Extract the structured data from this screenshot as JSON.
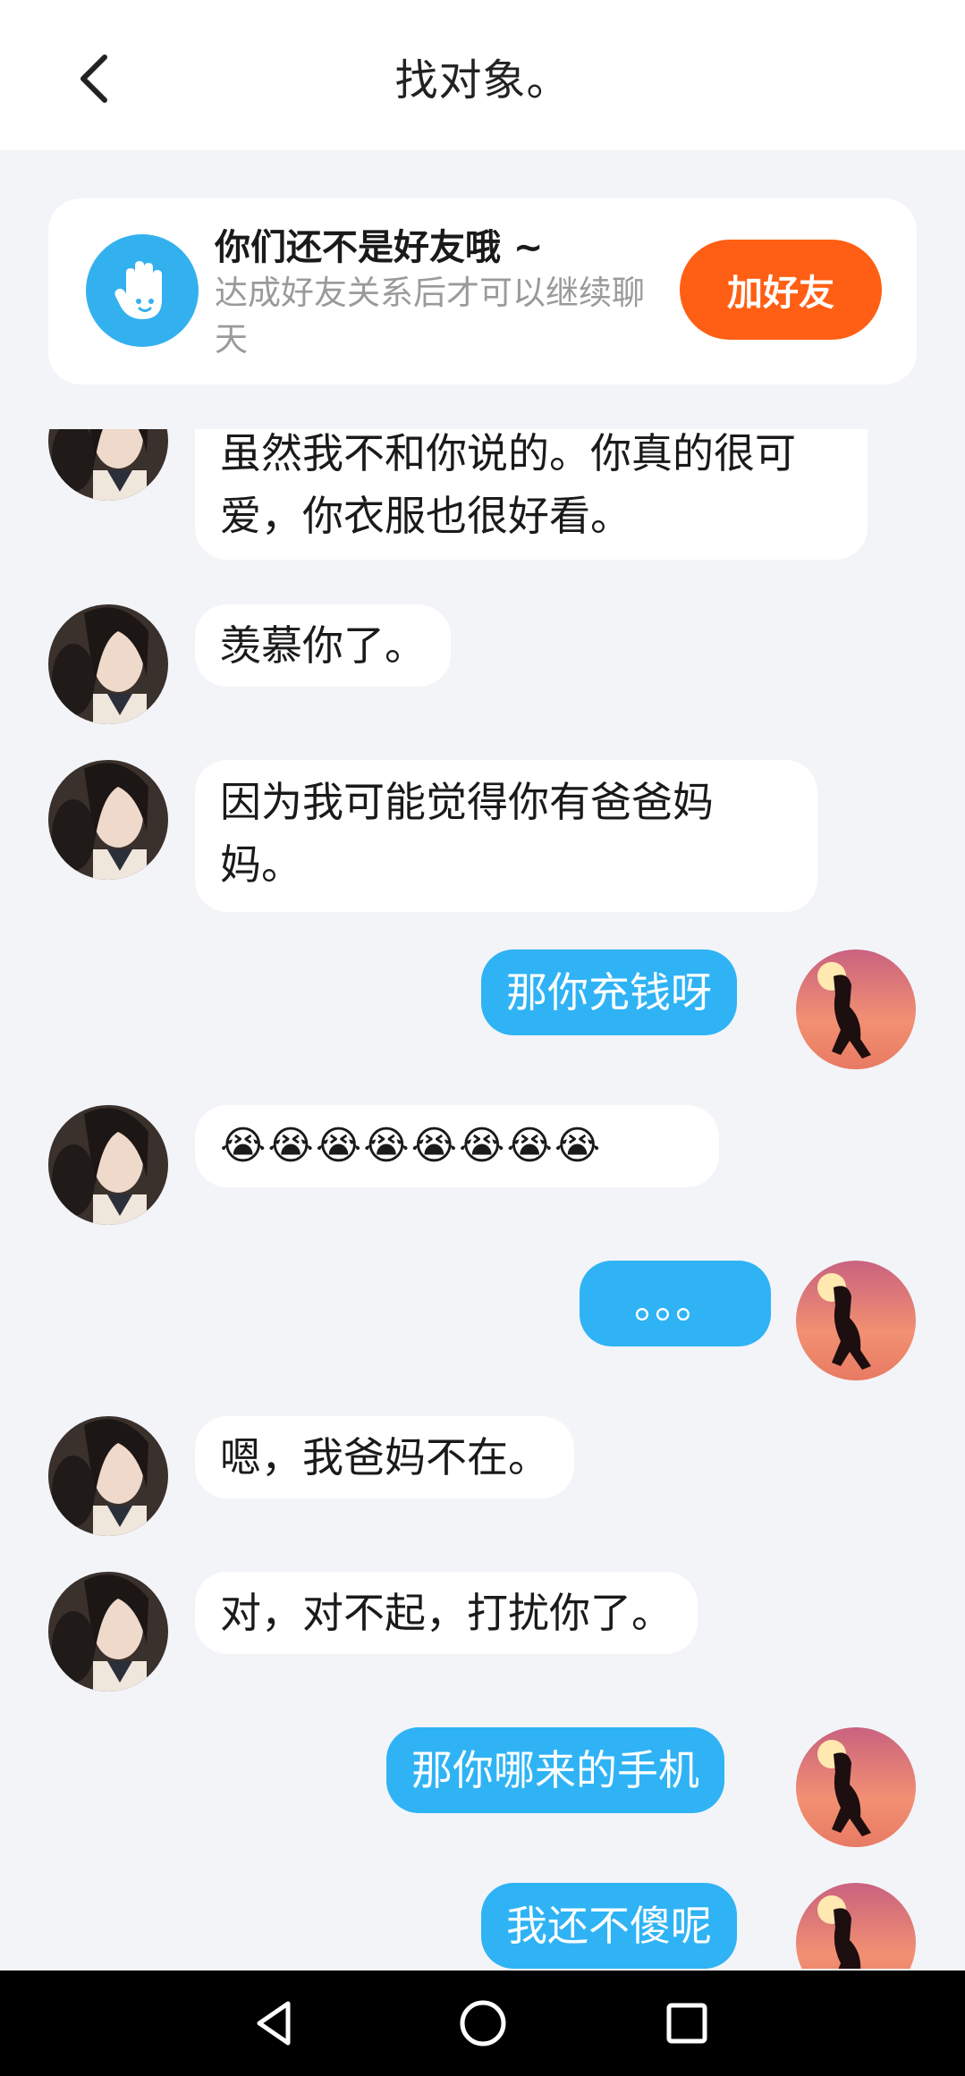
{
  "header": {
    "title": "找对象。"
  },
  "notice": {
    "title": "你们还不是好友哦 ~",
    "subtitle": "达成好友关系后才可以继续聊天",
    "add_button": "加好友"
  },
  "messages": [
    {
      "side": "in",
      "text": "虽然我不和你说的。你真的很可爱，你衣服也很好看。"
    },
    {
      "side": "in",
      "text": "羡慕你了。"
    },
    {
      "side": "in",
      "text": "因为我可能觉得你有爸爸妈妈。"
    },
    {
      "side": "out",
      "text": "那你充钱呀"
    },
    {
      "side": "in",
      "text": "😭😭😭😭😭😭😭😭"
    },
    {
      "side": "out",
      "text": "。。。"
    },
    {
      "side": "in",
      "text": "嗯，我爸妈不在。"
    },
    {
      "side": "in",
      "text": "对，对不起，打扰你了。"
    },
    {
      "side": "out",
      "text": "那你哪来的手机"
    },
    {
      "side": "out",
      "text": "我还不傻呢"
    }
  ],
  "colors": {
    "accent": "#2fb3f5",
    "add_button": "#ff5f14",
    "background": "#f2f4f8"
  },
  "icons": [
    "chevron-left-icon",
    "waving-hand-icon",
    "nav-back-icon",
    "nav-home-icon",
    "nav-recents-icon"
  ]
}
